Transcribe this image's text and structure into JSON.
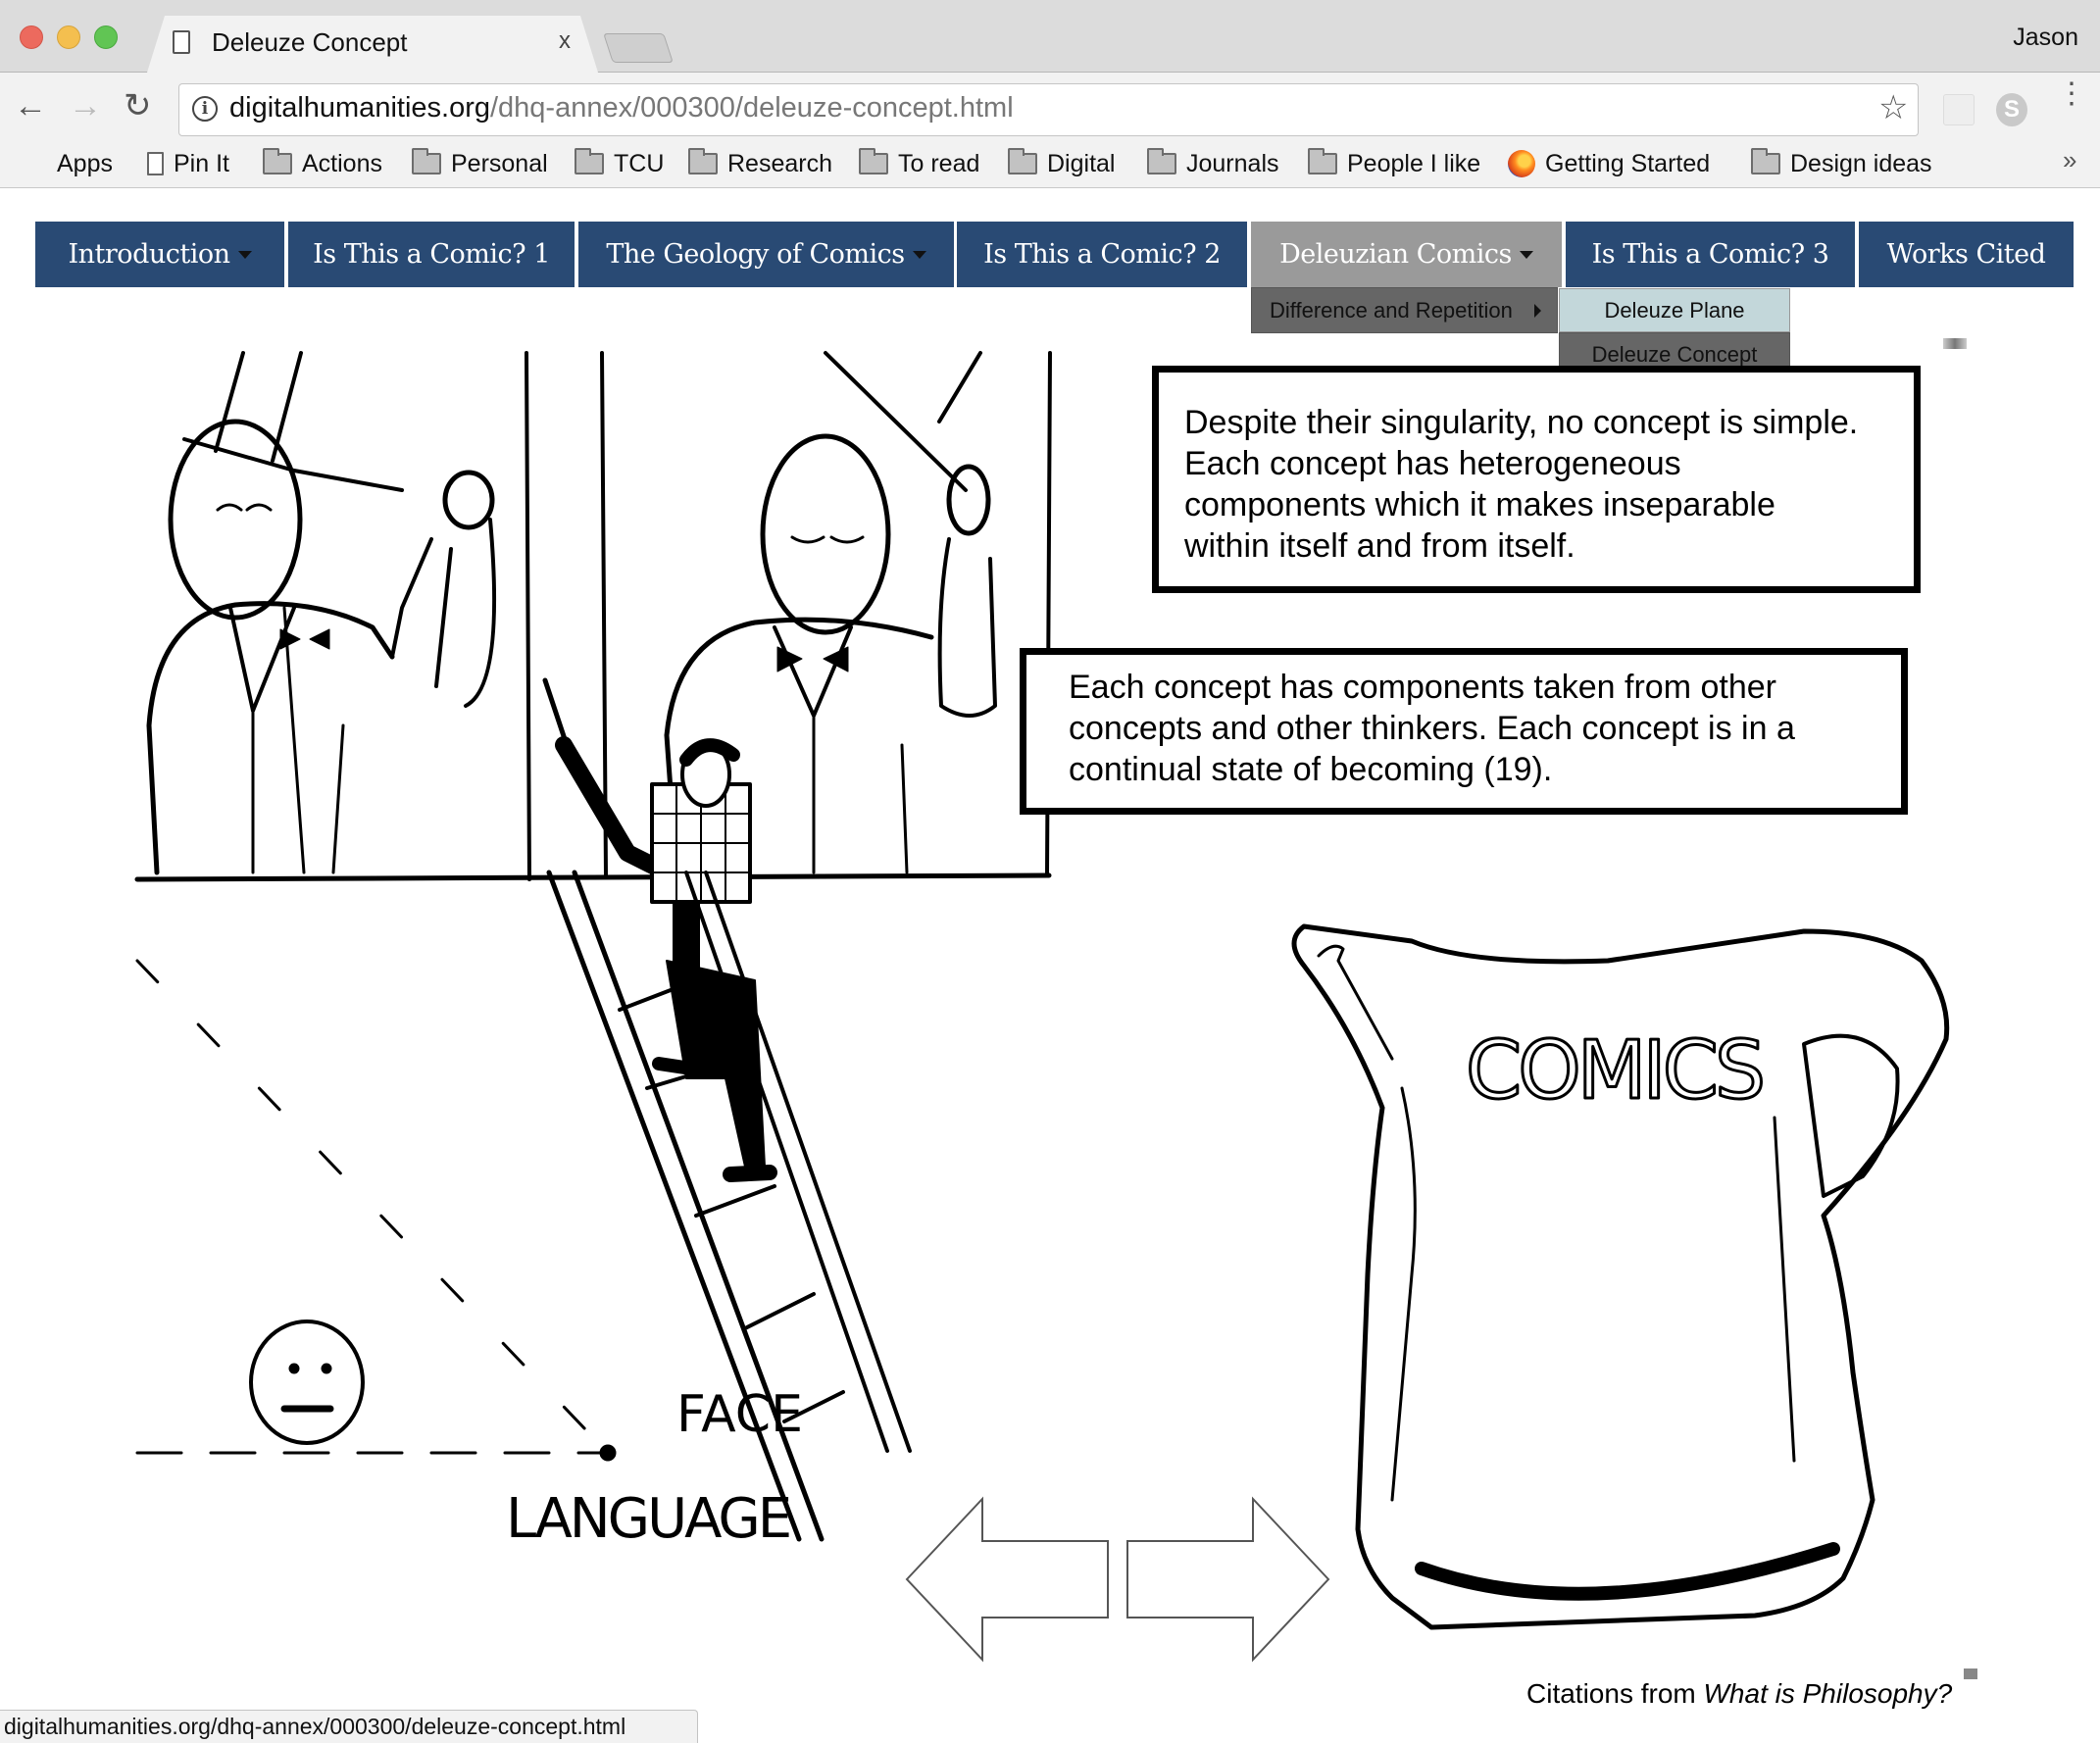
{
  "browser": {
    "tab_title": "Deleuze Concept",
    "tab_close": "x",
    "profile_name": "Jason",
    "url_host": "digitalhumanities.org",
    "url_path": "/dhq-annex/000300/deleuze-concept.html",
    "icons": {
      "back": "←",
      "forward": "→",
      "reload": "↻",
      "info": "i",
      "star": "☆",
      "menu": "⋮",
      "skype": "S",
      "more_bookmarks": "»"
    },
    "bookmarks": [
      {
        "label": "Apps",
        "icon": "apps-grid-icon"
      },
      {
        "label": "Pin It",
        "icon": "page-icon"
      },
      {
        "label": "Actions",
        "icon": "folder-icon"
      },
      {
        "label": "Personal",
        "icon": "folder-icon"
      },
      {
        "label": "TCU",
        "icon": "folder-icon"
      },
      {
        "label": "Research",
        "icon": "folder-icon"
      },
      {
        "label": "To read",
        "icon": "folder-icon"
      },
      {
        "label": "Digital",
        "icon": "folder-icon"
      },
      {
        "label": "Journals",
        "icon": "folder-icon"
      },
      {
        "label": "People I like",
        "icon": "folder-icon"
      },
      {
        "label": "Getting Started",
        "icon": "firefox-icon"
      },
      {
        "label": "Design ideas",
        "icon": "folder-icon"
      }
    ],
    "status_url": "digitalhumanities.org/dhq-annex/000300/deleuze-concept.html"
  },
  "nav": {
    "items": [
      {
        "label": "Introduction",
        "has_dropdown": true
      },
      {
        "label": "Is This a Comic? 1",
        "has_dropdown": false
      },
      {
        "label": "The Geology of Comics",
        "has_dropdown": true
      },
      {
        "label": "Is This a Comic? 2",
        "has_dropdown": false
      },
      {
        "label": "Deleuzian Comics",
        "has_dropdown": true,
        "active": true
      },
      {
        "label": "Is This a Comic? 3",
        "has_dropdown": false
      },
      {
        "label": "Works Cited",
        "has_dropdown": false
      }
    ],
    "dropdown": {
      "item": "Difference and Repetition",
      "submenu": [
        "Deleuze Plane",
        "Deleuze Concept"
      ]
    },
    "colors": {
      "bar": "#294a74",
      "active": "#9a9a9a",
      "dropdown": "#666666",
      "submenu_hover": "#c3d7da"
    }
  },
  "content": {
    "box1_lines": [
      "Despite their singularity, no concept is simple.",
      "Each concept has heterogeneous",
      "components which it makes inseparable",
      "within itself and from itself."
    ],
    "box2_lines": [
      "Each concept has components taken from other",
      "concepts and other thinkers. Each concept is in a",
      "continual state of becoming (19)."
    ],
    "comic_labels": {
      "language": "LANGUAGE",
      "face": "FACE",
      "jug": "COMICS"
    },
    "prev_arrow": "previous-page",
    "next_arrow": "next-page",
    "citation_prefix": "Citations from ",
    "citation_title": "What is Philosophy?"
  }
}
